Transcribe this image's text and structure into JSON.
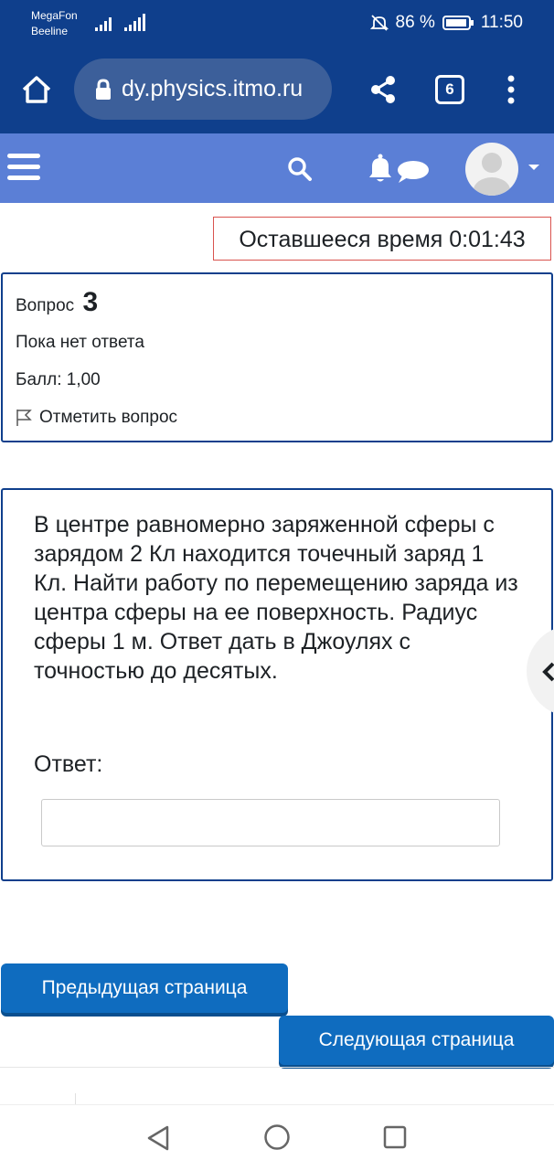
{
  "status_bar": {
    "carrier1": "MegaFon",
    "carrier2": "Beeline",
    "battery_percent": "86 %",
    "time": "11:50"
  },
  "browser": {
    "url": "dy.physics.itmo.ru",
    "tab_count": "6"
  },
  "timer": {
    "text": "Оставшееся время 0:01:43"
  },
  "question_info": {
    "label": "Вопрос",
    "number": "3",
    "status": "Пока нет ответа",
    "grade": "Балл: 1,00",
    "flag_label": "Отметить вопрос"
  },
  "question": {
    "text": "В центре равномерно заряженной сферы с зарядом 2 Кл находится точечный заряд 1 Кл. Найти работу по перемещению заряда из центра сферы на ее поверхность. Радиус сферы 1 м. Ответ дать в Джоулях с точностью до десятых.",
    "answer_label": "Ответ:",
    "answer_value": ""
  },
  "navigation": {
    "prev_label": "Предыдущая страница",
    "next_label": "Следующая страница"
  },
  "colors": {
    "browser_bar": "#0f3f8c",
    "navbar": "#5b7fd6",
    "primary_button": "#0f6cbf",
    "timer_border": "#d9534f"
  },
  "icons": {
    "home": "home-icon",
    "lock": "lock-icon",
    "share": "share-icon",
    "menu": "more-vertical-icon",
    "hamburger": "hamburger-icon",
    "search": "search-icon",
    "bell": "bell-icon",
    "chat": "chat-icon",
    "flag": "flag-icon",
    "drawer": "chevron-left-icon"
  }
}
